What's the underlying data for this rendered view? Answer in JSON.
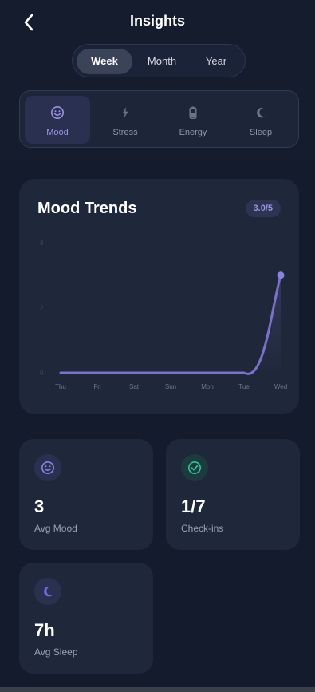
{
  "header": {
    "title": "Insights",
    "back_icon": "chevron-left-icon"
  },
  "period_tabs": [
    {
      "label": "Week",
      "active": true
    },
    {
      "label": "Month",
      "active": false
    },
    {
      "label": "Year",
      "active": false
    }
  ],
  "metric_tabs": [
    {
      "label": "Mood",
      "icon": "smile-icon",
      "active": true
    },
    {
      "label": "Stress",
      "icon": "bolt-icon",
      "active": false
    },
    {
      "label": "Energy",
      "icon": "battery-icon",
      "active": false
    },
    {
      "label": "Sleep",
      "icon": "moon-icon",
      "active": false
    }
  ],
  "chart_card": {
    "title": "Mood Trends",
    "badge": "3.0/5"
  },
  "chart_data": {
    "type": "line",
    "title": "Mood Trends",
    "categories": [
      "Thu",
      "Fri",
      "Sat",
      "Sun",
      "Mon",
      "Tue",
      "Wed"
    ],
    "values": [
      0,
      0,
      0,
      0,
      0,
      0,
      3
    ],
    "y_ticks": [
      "0",
      "2",
      "4"
    ],
    "ylim": [
      0,
      4
    ],
    "grid": false,
    "line_color": "#7a72c9"
  },
  "stats": [
    {
      "value": "3",
      "label": "Avg Mood",
      "icon": "smile-icon",
      "icon_color": "#8b84e3",
      "icon_bg": "#2a3150"
    },
    {
      "value": "1/7",
      "label": "Check-ins",
      "icon": "check-circle-icon",
      "icon_color": "#2ec4a0",
      "icon_bg": "#1d3a3e"
    },
    {
      "value": "7h",
      "label": "Avg Sleep",
      "icon": "moon-icon",
      "icon_color": "#6f6ae0",
      "icon_bg": "#2a3150"
    }
  ]
}
